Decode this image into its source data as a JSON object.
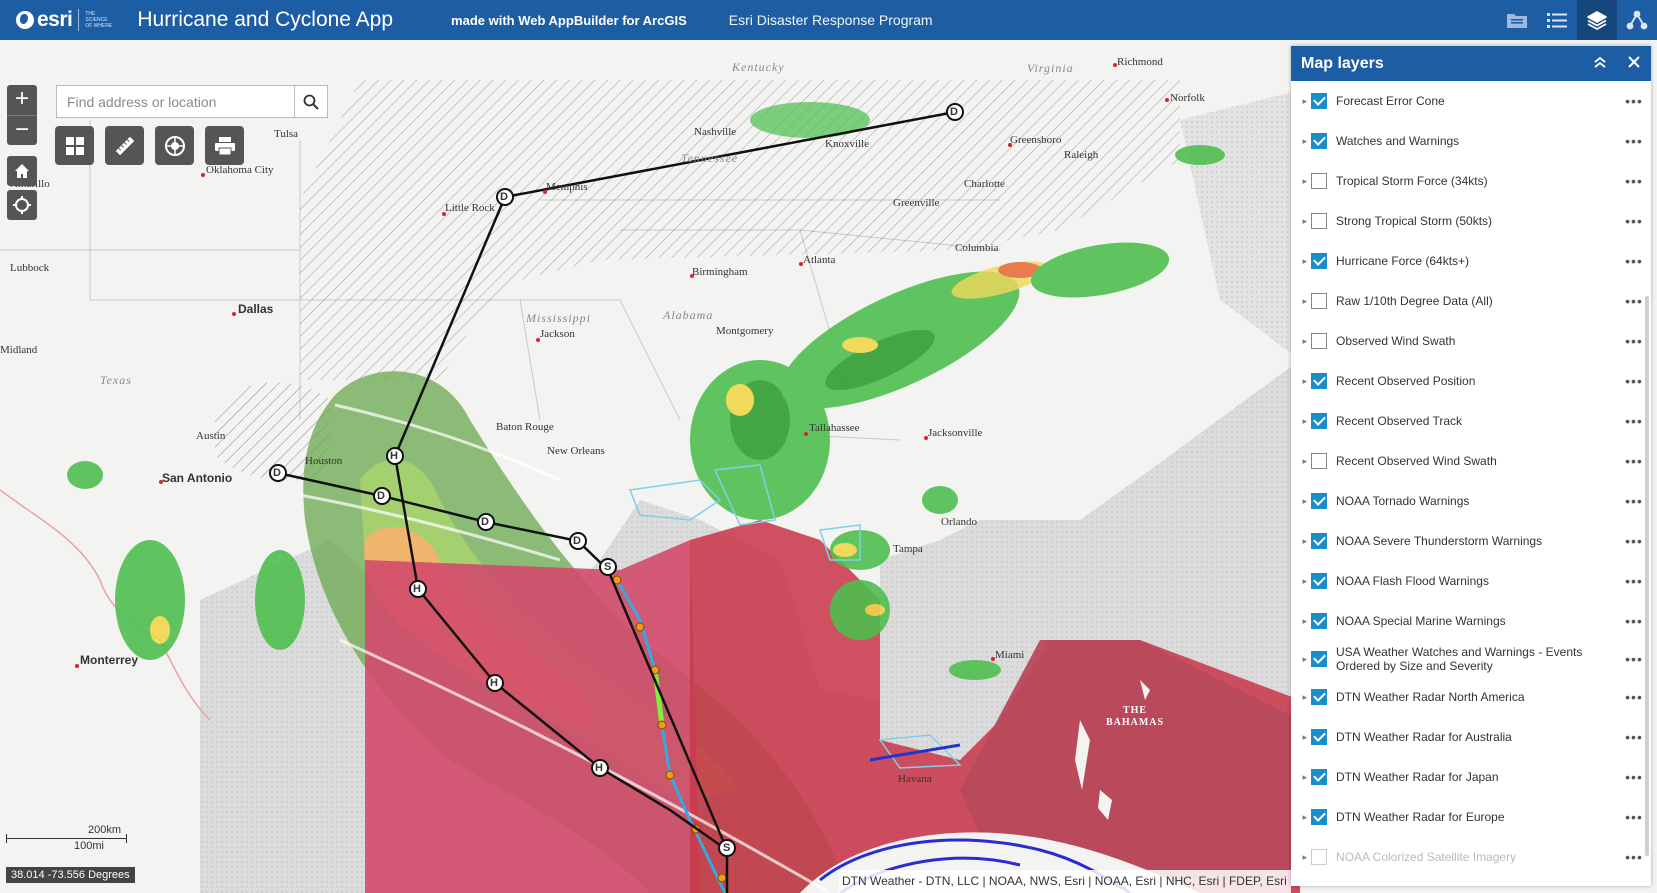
{
  "header": {
    "logo_text": "esri",
    "logo_tagline": "THE SCIENCE OF WHERE",
    "title": "Hurricane and Cyclone App",
    "subtitle": "made with Web AppBuilder for ArcGIS",
    "program": "Esri Disaster Response Program",
    "icons": [
      "folder-icon",
      "legend-list-icon",
      "layers-icon",
      "share-icon"
    ]
  },
  "search": {
    "placeholder": "Find address or location"
  },
  "controls": {
    "zoom_in": "+",
    "zoom_out": "−"
  },
  "map": {
    "cities": [
      "Richmond",
      "Norfolk",
      "Greensboro",
      "Raleigh",
      "Charlotte",
      "Greenville",
      "Columbia",
      "Atlanta",
      "Birmingham",
      "Montgomery",
      "Nashville",
      "Knoxville",
      "Memphis",
      "Little Rock",
      "Tulsa",
      "Oklahoma City",
      "Amarillo",
      "Lubbock",
      "Dallas",
      "Midland",
      "Austin",
      "San Antonio",
      "Houston",
      "Baton Rouge",
      "New Orleans",
      "Jackson",
      "Tallahassee",
      "Jacksonville",
      "Orlando",
      "Tampa",
      "Miami",
      "Havana",
      "Monterrey"
    ],
    "states": [
      "Kentucky",
      "Virginia",
      "Tennessee",
      "Mississippi",
      "Alabama",
      "Texas"
    ],
    "region": "THE BAHAMAS",
    "track_labels": [
      "D",
      "H",
      "S"
    ],
    "scale_km": "200km",
    "scale_mi": "100mi",
    "coordinates": "38.014 -73.556 Degrees",
    "attribution": "DTN Weather - DTN, LLC | NOAA, NWS, Esri | NOAA, Esri | NHC, Esri | FDEP, Esri"
  },
  "panel": {
    "title": "Map layers",
    "layers": [
      {
        "name": "Forecast Error Cone",
        "checked": true
      },
      {
        "name": "Watches and Warnings",
        "checked": true
      },
      {
        "name": "Tropical Storm Force (34kts)",
        "checked": false
      },
      {
        "name": "Strong Tropical Storm (50kts)",
        "checked": false
      },
      {
        "name": "Hurricane Force (64kts+)",
        "checked": true
      },
      {
        "name": "Raw 1/10th Degree Data (All)",
        "checked": false
      },
      {
        "name": "Observed Wind Swath",
        "checked": false
      },
      {
        "name": "Recent Observed Position",
        "checked": true
      },
      {
        "name": "Recent Observed Track",
        "checked": true
      },
      {
        "name": "Recent Observed Wind Swath",
        "checked": false
      },
      {
        "name": "NOAA Tornado Warnings",
        "checked": true
      },
      {
        "name": "NOAA Severe Thunderstorm Warnings",
        "checked": true
      },
      {
        "name": "NOAA Flash Flood Warnings",
        "checked": true
      },
      {
        "name": "NOAA Special Marine Warnings",
        "checked": true
      },
      {
        "name": "USA Weather Watches and Warnings - Events Ordered by Size and Severity",
        "checked": true
      },
      {
        "name": "DTN Weather Radar North America",
        "checked": true
      },
      {
        "name": "DTN Weather Radar for Australia",
        "checked": true
      },
      {
        "name": "DTN Weather Radar for Japan",
        "checked": true
      },
      {
        "name": "DTN Weather Radar for Europe",
        "checked": true
      },
      {
        "name": "NOAA Colorized Satellite Imagery",
        "checked": false
      }
    ]
  },
  "colors": {
    "header": "#1d5da3",
    "warning_red": "#c9394b",
    "cone_green": "#6aa84f",
    "cone_orange": "#e69138",
    "track_line": "#111111",
    "checkbox": "#1a8dcb"
  }
}
